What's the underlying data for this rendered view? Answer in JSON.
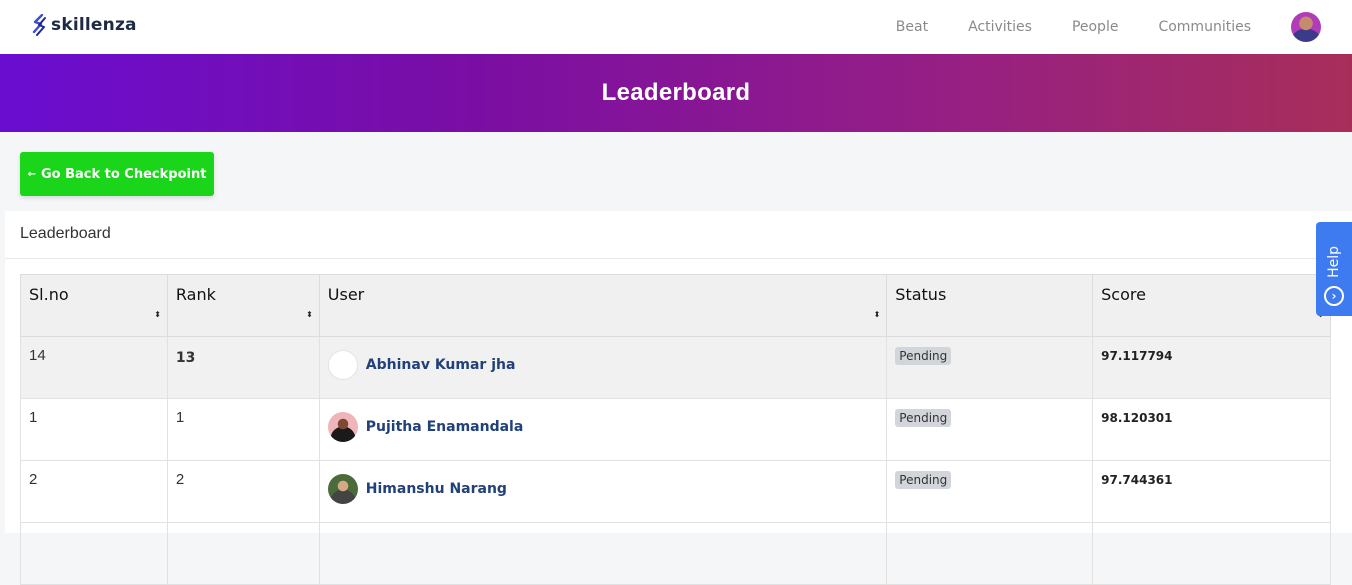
{
  "brand": {
    "name": "skillenza"
  },
  "nav": {
    "items": [
      "Beat",
      "Activities",
      "People",
      "Communities"
    ]
  },
  "hero": {
    "title": "Leaderboard"
  },
  "back_button": {
    "arrow": "←",
    "label": "Go Back to Checkpoint"
  },
  "card": {
    "title": "Leaderboard"
  },
  "table": {
    "headers": [
      "Sl.no",
      "Rank",
      "User",
      "Status",
      "Score"
    ],
    "sort_icon": "⬍",
    "rows": [
      {
        "slno": "14",
        "rank": "13",
        "user": "Abhinav Kumar jha",
        "status": "Pending",
        "score": "97.117794"
      },
      {
        "slno": "1",
        "rank": "1",
        "user": "Pujitha Enamandala",
        "status": "Pending",
        "score": "98.120301"
      },
      {
        "slno": "2",
        "rank": "2",
        "user": "Himanshu Narang",
        "status": "Pending",
        "score": "97.744361"
      }
    ]
  },
  "help": {
    "label": "Help"
  },
  "colors": {
    "accent_green": "#1ad51a",
    "hero_start": "#6a0dd0",
    "hero_end": "#a82e5a",
    "help_blue": "#3e7bf0",
    "link_blue": "#22407a"
  },
  "icons": {
    "logo": "skillenza-logo-icon",
    "help": "help-circle-icon",
    "sort": "sort-icon",
    "avatar": "user-avatar-icon"
  }
}
